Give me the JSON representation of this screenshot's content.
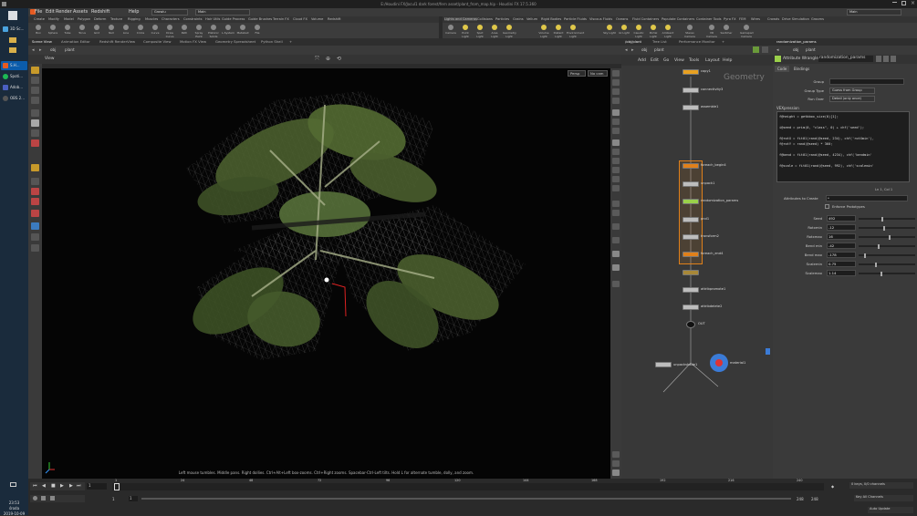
{
  "window": {
    "title": "E:/Houdini FX/Jocul1 dark forest/fern asset/plant_from_map.hip - Houdini FX 17.5.360"
  },
  "taskbar": {
    "items": [
      "3D Sc...",
      "S.H...",
      "Spoti...",
      "Adob...",
      "OBS 2..."
    ],
    "time": "23:53",
    "day": "środa",
    "date": "2019-10-09"
  },
  "menubar": {
    "items": [
      "File",
      "Edit",
      "Render",
      "Assets",
      "Redshift",
      "Help"
    ],
    "build_dropdown": "Growlu",
    "desktop_dropdown": "Main",
    "right_dropdown": "Main"
  },
  "shelf_tabs_left": [
    "Create",
    "Modify",
    "Model",
    "Polygon",
    "Deform",
    "Texture",
    "Rigging",
    "Muscles",
    "Characters",
    "Constraints",
    "Hair Utils",
    "Guide Process",
    "Guide Brushes",
    "Terrain FX",
    "Cloud FX",
    "Volume",
    "Redshift"
  ],
  "shelf_tools_left": [
    "Box",
    "Sphere",
    "Tube",
    "Torus",
    "Grid",
    "Null",
    "Line",
    "Circle",
    "Curve",
    "Draw Curve",
    "Path",
    "Spray Paint",
    "Platonic Solids",
    "L-System",
    "Metaball",
    "File"
  ],
  "shelf_tabs_right": [
    "Lights and Cameras",
    "Collisions",
    "Particles",
    "Grains",
    "Vellum",
    "Rigid Bodies",
    "Particle Fluids",
    "Viscous Fluids",
    "Oceans",
    "Fluid Containers",
    "Populate Containers",
    "Container Tools",
    "Pyro FX",
    "FEM",
    "Wires",
    "Crowds",
    "Drive Simulation",
    "Grooms"
  ],
  "shelf_tools_right": [
    "Camera",
    "Point Light",
    "Spot Light",
    "Area Light",
    "Geometry Light",
    "Volume Light",
    "Distant Light",
    "Environment Light",
    "Sky Light",
    "GI Light",
    "Caustic Light",
    "Portal Light",
    "Ambient Light",
    "Stereo Camera",
    "VR Camera",
    "Switcher",
    "Gamepad Camera"
  ],
  "pane_tabs": [
    "Scene View",
    "Animation Editor",
    "Redshift RenderView",
    "Composite View",
    "Motion FX View",
    "Geometry Spreadsheet",
    "Python Shell"
  ],
  "net_tabs": [
    "/obj/plant",
    "Tree List",
    "Performance Monitor"
  ],
  "parm_tabs": [
    "randomization_params"
  ],
  "viewer": {
    "path_obj": "obj",
    "path_node": "plant",
    "view_label": "View",
    "persp": "Persp",
    "cam": "No cam",
    "status": "Left mouse tumbles. Middle pans. Right dollies. Ctrl+Alt+Left box-zooms. Ctrl+Right zooms. Spacebar-Ctrl-Left tilts. Hold L for alternate tumble, dolly, and zoom."
  },
  "network": {
    "path_obj": "obj",
    "path_node": "plant",
    "menu": [
      "Add",
      "Edit",
      "Go",
      "View",
      "Tools",
      "Layout",
      "Help"
    ],
    "context_label": "Geometry",
    "nodes": [
      "copy1",
      "connectivity3",
      "assemble1",
      "foreach_begin4",
      "unpack1",
      "randomization_params",
      "pnd1",
      "transform2",
      "foreach_end4",
      "attribpromote1",
      "attribdelete2",
      "OUT",
      "unpackshade1",
      "material1"
    ],
    "node_sub": [
      "",
      "",
      "",
      "",
      "",
      "",
      "",
      "",
      "Gather - /4",
      "",
      "",
      "",
      "",
      ""
    ]
  },
  "parms": {
    "node_type": "Attribute Wrangle",
    "node_name": "randomization_params",
    "tabs": [
      "Code",
      "Bindings"
    ],
    "group_label": "Group",
    "group_type_label": "Group Type",
    "group_type": "Guess from Group",
    "run_over_label": "Run Over",
    "run_over": "Detail (only once)",
    "vex_label": "VEXpression",
    "code": [
      "f@height = getbbox_size(0)[1];",
      "",
      "i@seed = prim(0, \"class\", 0) + chf('seed');",
      "",
      "f@rotX = fit01(rand(@seed, 234), chf('rotXmin'),",
      "f@rotY = rand(@seed) * 360;",
      "",
      "f@bend = fit01(rand(@seed, 4234), chf('bendmin'",
      "",
      "f@scale = fit01(rand(@seed, 992), chf('scalemin'"
    ],
    "cursor": "Ln 1, Col 1",
    "attr_create_label": "Attributes to Create",
    "attr_create": "*",
    "enforce_label": "Enforce Prototypes",
    "rows": [
      {
        "label": "Seed",
        "value": "492",
        "frac": 0.42
      },
      {
        "label": "Rotxmin",
        "value": "-12",
        "frac": 0.45
      },
      {
        "label": "Rotxmax",
        "value": "16",
        "frac": 0.55
      },
      {
        "label": "Bend min",
        "value": "-42",
        "frac": 0.35
      },
      {
        "label": "Bend max",
        "value": "-178",
        "frac": 0.1
      },
      {
        "label": "Scalemin",
        "value": "0.75",
        "frac": 0.3
      },
      {
        "label": "Scalemax",
        "value": "1.14",
        "frac": 0.4
      }
    ]
  },
  "timeline": {
    "frame": "1",
    "start": "1",
    "start2": "1",
    "end": "248",
    "end2": "248",
    "keys": "0 keys, 0/0 channels",
    "keyall": "Key All Channels",
    "autoupdate": "Auto Update",
    "ticks": [
      "1",
      "24",
      "48",
      "72",
      "96",
      "120",
      "144",
      "168",
      "192",
      "216",
      "240"
    ]
  }
}
